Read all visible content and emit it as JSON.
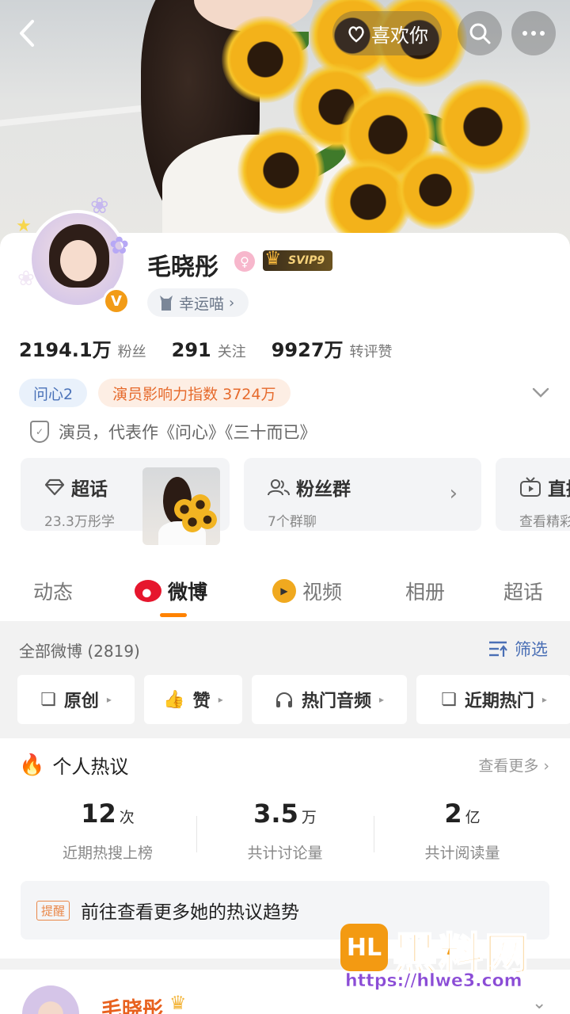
{
  "header": {
    "back_icon": "chevron-left-icon",
    "like_label": "喜欢你",
    "like_icon": "heart-hand-icon",
    "search_icon": "search-icon",
    "more_icon": "more-dots-icon"
  },
  "profile": {
    "name": "毛晓彤",
    "gender_icon": "female-icon",
    "vip_label": "SVIP9",
    "verified_badge": "V",
    "pet_label": "幸运喵",
    "stats": [
      {
        "num": "2194.1万",
        "label": "粉丝"
      },
      {
        "num": "291",
        "label": "关注"
      },
      {
        "num": "9927万",
        "label": "转评赞"
      }
    ],
    "tags": [
      "问心2",
      "演员影响力指数 3724万"
    ],
    "verification": "演员，代表作《问心》《三十而已》"
  },
  "feature_cards": [
    {
      "title": "超话",
      "subtitle": "23.3万彤学",
      "icon": "diamond-icon"
    },
    {
      "title": "粉丝群",
      "subtitle": "7个群聊",
      "icon": "group-icon"
    },
    {
      "title": "直播",
      "subtitle": "查看精彩",
      "icon": "tv-icon"
    }
  ],
  "tabs": [
    "动态",
    "微博",
    "视频",
    "相册",
    "超话"
  ],
  "active_tab": "微博",
  "filter": {
    "all_label": "全部微博 (2819)",
    "filter_label": "筛选",
    "chips": [
      {
        "label": "原创",
        "icon": "layers-icon"
      },
      {
        "label": "赞",
        "icon": "thumbs-up-icon"
      },
      {
        "label": "热门音频",
        "icon": "headphones-icon"
      },
      {
        "label": "近期热门",
        "icon": "layers-icon"
      }
    ]
  },
  "hot": {
    "title": "个人热议",
    "see_more": "查看更多 ›",
    "stats": [
      {
        "value": "12",
        "unit": "次",
        "label": "近期热搜上榜"
      },
      {
        "value": "3.5",
        "unit": "万",
        "label": "共计讨论量"
      },
      {
        "value": "2",
        "unit": "亿",
        "label": "共计阅读量"
      }
    ],
    "reminder_tag": "提醒",
    "reminder_text": "前往查看更多她的热议趋势"
  },
  "next_post": {
    "name": "毛晓彤"
  },
  "watermark": {
    "brand": "黑料网",
    "url": "https://hlwe3.com",
    "logo": "HL"
  },
  "colors": {
    "accent": "#ff8200",
    "weibo_red": "#e6162d",
    "link_blue": "#4a6fb5",
    "orange_tag": "#e66a2c"
  }
}
